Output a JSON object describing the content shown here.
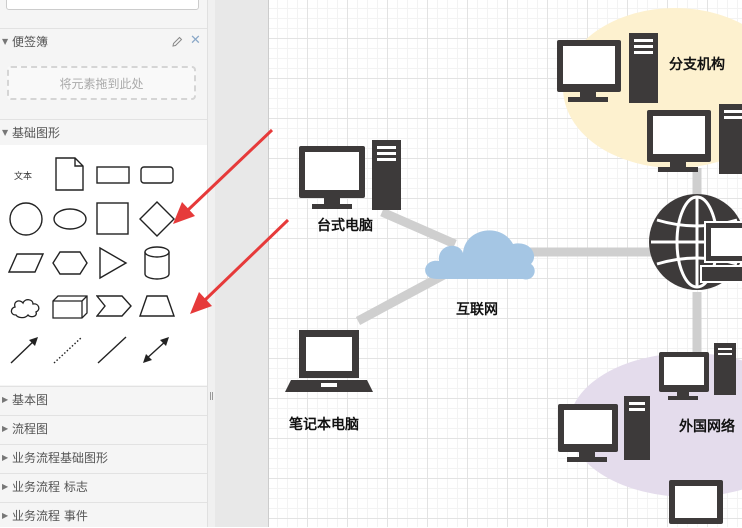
{
  "sidebar": {
    "sticky_notes": {
      "title": "便签簿",
      "drop_placeholder": "将元素拖到此处"
    },
    "basic_shapes": {
      "title": "基础图形",
      "text_shape_label": "文本"
    },
    "categories": [
      {
        "label": "基本图"
      },
      {
        "label": "流程图"
      },
      {
        "label": "业务流程基础图形"
      },
      {
        "label": "业务流程 标志"
      },
      {
        "label": "业务流程 事件"
      }
    ]
  },
  "canvas": {
    "labels": {
      "desktop": "台式电脑",
      "internet": "互联网",
      "laptop": "笔记本电脑",
      "branch": "分支机构",
      "foreign_network": "外国网络"
    }
  },
  "annotation_color": "#e63a3a",
  "icon_color": "#3d3a3a"
}
